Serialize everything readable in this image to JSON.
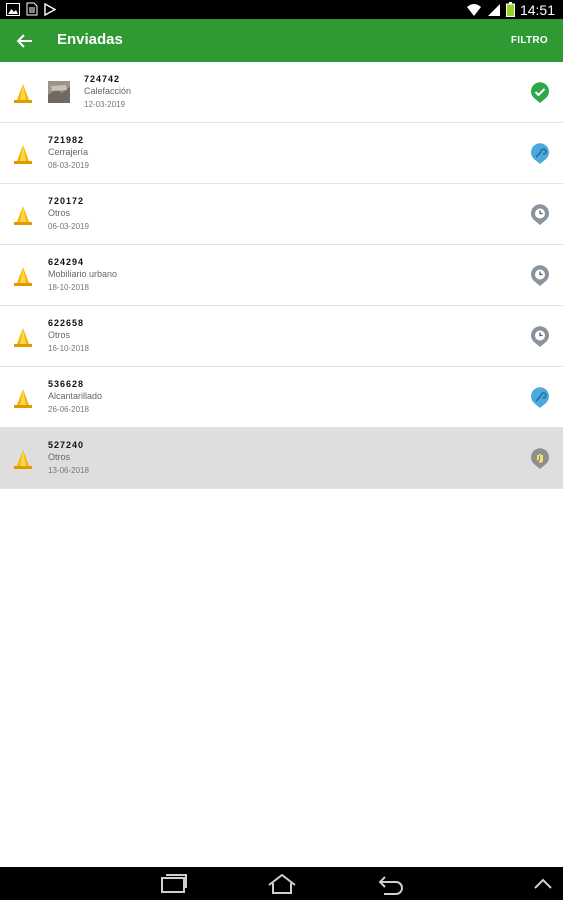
{
  "status_bar": {
    "time": "14:51",
    "left_icons": [
      "image-icon",
      "file-icon",
      "play-store-icon"
    ],
    "right_icons": [
      "wifi-icon",
      "signal-icon",
      "battery-icon"
    ]
  },
  "app_bar": {
    "title": "Enviadas",
    "filter_label": "FILTRO",
    "color": "#2f9a33"
  },
  "items": [
    {
      "number": "724742",
      "category": "Calefacción",
      "date": "12-03-2019",
      "status_icon": "check-icon",
      "status_color": "#2fa84a",
      "has_thumbnail": true
    },
    {
      "number": "721982",
      "category": "Cerrajería",
      "date": "08-03-2019",
      "status_icon": "wrench-icon",
      "status_color": "#4aa9dd",
      "has_thumbnail": false
    },
    {
      "number": "720172",
      "category": "Otros",
      "date": "06-03-2019",
      "status_icon": "clock-icon",
      "status_color": "#8a949e",
      "has_thumbnail": false
    },
    {
      "number": "624294",
      "category": "Mobiliario urbano",
      "date": "18-10-2018",
      "status_icon": "clock-icon",
      "status_color": "#8a949e",
      "has_thumbnail": false
    },
    {
      "number": "622658",
      "category": "Otros",
      "date": "16-10-2018",
      "status_icon": "clock-icon",
      "status_color": "#8a949e",
      "has_thumbnail": false
    },
    {
      "number": "536628",
      "category": "Alcantarillado",
      "date": "26-06-2018",
      "status_icon": "wrench-icon",
      "status_color": "#4aa9dd",
      "has_thumbnail": false
    },
    {
      "number": "527240",
      "category": "Otros",
      "date": "13-06-2018",
      "status_icon": "hand-icon",
      "status_color": "#8f8f8f",
      "has_thumbnail": false,
      "selected": true
    }
  ],
  "nav_bar": {
    "buttons": [
      "recent-apps-icon",
      "home-icon",
      "back-icon",
      "chevron-up-icon"
    ]
  }
}
